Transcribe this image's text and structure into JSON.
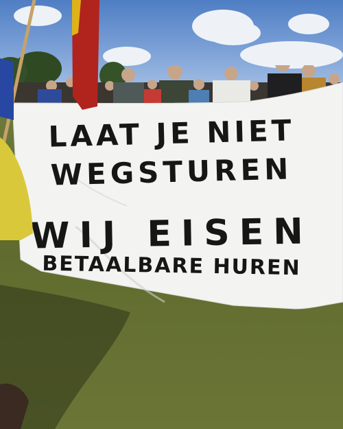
{
  "banner": {
    "line1": "LAAT JE NIET",
    "line2": "WEGSTUREN",
    "line3": "WIJ EISEN",
    "line4": "BETAALBARE HUREN"
  },
  "colors": {
    "sky": "#6f96cf",
    "cloud": "#eef2f7",
    "banner": "#f3f3f1",
    "ink": "#161616",
    "grass": "#66722f",
    "flag_red": "#b1231d",
    "flag_yellow": "#e0b21a",
    "jacket": "#d9c93a"
  }
}
